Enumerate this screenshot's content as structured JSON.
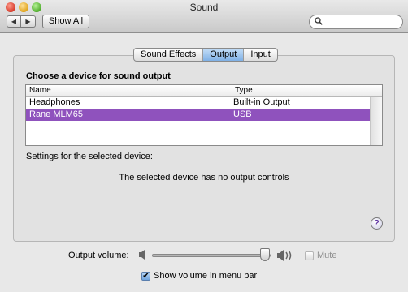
{
  "window": {
    "title": "Sound",
    "back_icon": "◀",
    "forward_icon": "▶",
    "show_all_label": "Show All",
    "search_placeholder": "",
    "search_icon_glyph": "🔍"
  },
  "tabs": [
    {
      "label": "Sound Effects",
      "selected": false
    },
    {
      "label": "Output",
      "selected": true
    },
    {
      "label": "Input",
      "selected": false
    }
  ],
  "output": {
    "choose_heading": "Choose a device for sound output",
    "columns": {
      "name": "Name",
      "type": "Type"
    },
    "devices": [
      {
        "name": "Headphones",
        "type": "Built-in Output",
        "selected": false
      },
      {
        "name": "Rane MLM65",
        "type": "USB",
        "selected": true
      }
    ],
    "settings_label": "Settings for the selected device:",
    "no_controls_message": "The selected device has no output controls",
    "help_glyph": "?"
  },
  "footer": {
    "volume_label": "Output volume:",
    "volume_level": 0.92,
    "speaker_low_glyph": "🔈",
    "speaker_high_glyph": "🔊",
    "mute_label": "Mute",
    "mute_checked": false,
    "mute_enabled": false,
    "show_volume_label": "Show volume in menu bar",
    "show_volume_checked": true,
    "checkmark_glyph": "✔"
  },
  "colors": {
    "selection": "#8f52bd",
    "tab_selected": "#7fb0e6"
  }
}
